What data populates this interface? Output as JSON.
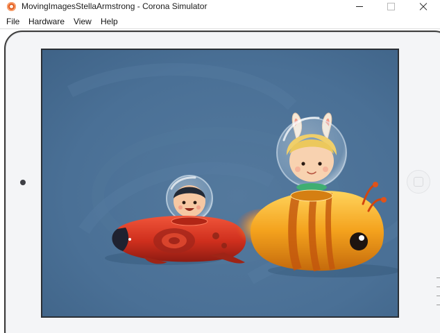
{
  "window": {
    "title": "MovingImagesStellaArmstrong - Corona Simulator",
    "icon": "corona-logo-icon",
    "controls": [
      "minimize-icon",
      "maximize-icon",
      "close-icon"
    ]
  },
  "menu": {
    "items": [
      {
        "label": "File"
      },
      {
        "label": "Hardware"
      },
      {
        "label": "View"
      },
      {
        "label": "Help"
      }
    ]
  },
  "simulator": {
    "device": "tablet",
    "scene": {
      "background_color": "#4a7096",
      "sprites": [
        {
          "name": "red-rocket-astronaut-boy",
          "description_icon": "rocket-ship-icon"
        },
        {
          "name": "yellow-bee-rocket-astronaut-girl",
          "description_icon": "rocket-ship-icon"
        }
      ]
    }
  },
  "colors": {
    "accent": "#e2581c",
    "screen_background": "#4a7096",
    "red_rocket": "#d0311f",
    "yellow_rocket": "#f2a11b"
  }
}
